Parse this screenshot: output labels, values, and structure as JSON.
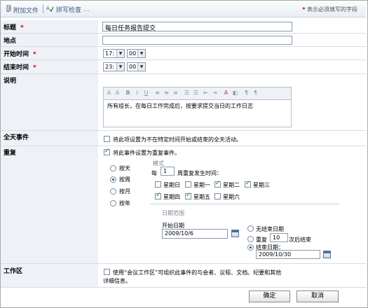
{
  "toolbar": {
    "attach_label": "附加文件",
    "spell_label": "拼写检查",
    "spell_dots": "...",
    "required_note": "表示必须填写的字段"
  },
  "fields": {
    "title_label": "标题",
    "title_value": "每日任务报告提交",
    "location_label": "地点",
    "location_value": "",
    "start_label": "开始时间",
    "start_hour": "17:",
    "start_min": "00",
    "end_label": "结束时间",
    "end_hour": "23:",
    "end_min": "00",
    "desc_label": "说明",
    "desc_value": "所有组长，在每日工作完成后，按要求提交当日的工作日志",
    "allday_label": "全天事件",
    "allday_text": "将此项设置为不在特定时间开始或结束的全天活动。",
    "recur_label": "重复",
    "recur_text": "将此事件设置为重复事件。",
    "workspace_label": "工作区",
    "workspace_text_1": "使用“会议工作区”可组织此事件的与会者、议程、文档、纪要和其他",
    "workspace_text_2": "详细信息。"
  },
  "recurrence": {
    "freq_options": [
      "按天",
      "按周",
      "按月",
      "按年"
    ],
    "pattern_legend": "模式",
    "every_label": "每",
    "every_value": "1",
    "every_suffix": "周重复发生时间：",
    "weekdays": [
      "星期日",
      "星期一",
      "星期二",
      "星期三",
      "星期四",
      "星期五",
      "星期六"
    ],
    "weekdays_checked": [
      false,
      false,
      true,
      true,
      true,
      true,
      false
    ],
    "range_legend": "日期范围",
    "start_date_label": "开始日期",
    "start_date_value": "2009/10/6",
    "no_end_label": "无结束日期",
    "repeat_label": "重复",
    "repeat_count": "10",
    "repeat_suffix": "次后结束",
    "end_by_label": "结束日期：",
    "end_by_value": "2009/10/30"
  },
  "buttons": {
    "ok": "确定",
    "cancel": "取消"
  },
  "required_star": "*"
}
